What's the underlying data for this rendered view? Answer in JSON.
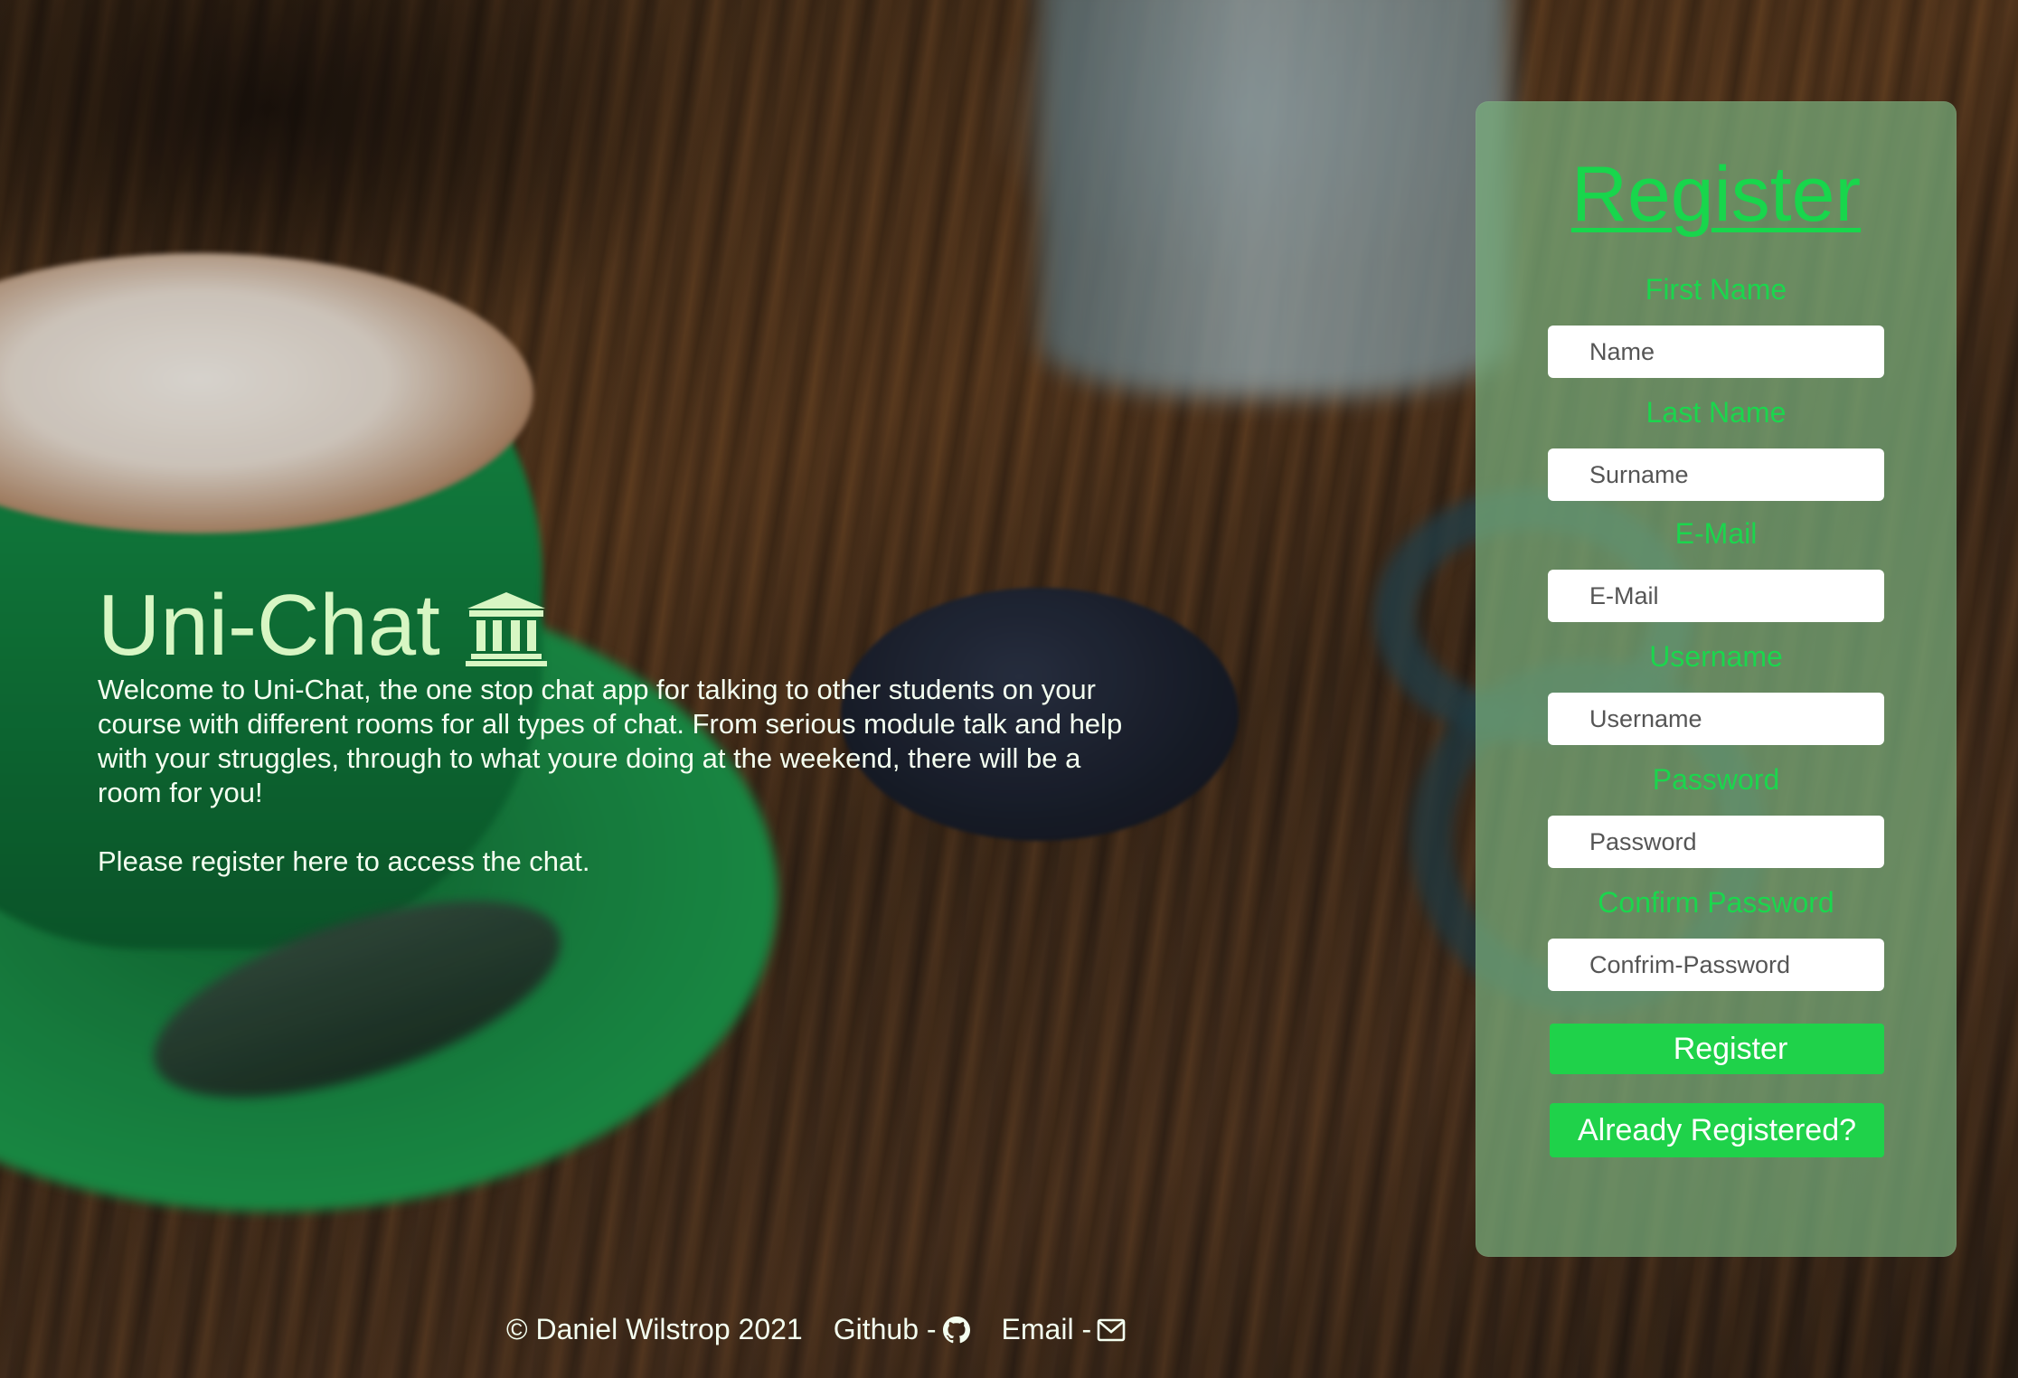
{
  "app": {
    "title": "Uni-Chat",
    "title_icon": "bank-icon"
  },
  "hero": {
    "description": "Welcome to Uni-Chat, the one stop chat app for talking to other students on your course with different rooms for all types of chat. From serious module talk and help with your struggles, through to what youre doing at the weekend, there will be a room for you!",
    "cta": "Please register here to access the chat."
  },
  "register_form": {
    "heading": "Register",
    "fields": [
      {
        "label": "First Name",
        "placeholder": "Name"
      },
      {
        "label": "Last Name",
        "placeholder": "Surname"
      },
      {
        "label": "E-Mail",
        "placeholder": "E-Mail"
      },
      {
        "label": "Username",
        "placeholder": "Username"
      },
      {
        "label": "Password",
        "placeholder": "Password"
      },
      {
        "label": "Confirm Password",
        "placeholder": "Confrim-Password"
      }
    ],
    "submit_label": "Register",
    "login_label": "Already Registered?"
  },
  "footer": {
    "copyright": "© Daniel Wilstrop 2021",
    "github_label": "Github -",
    "github_icon": "github-icon",
    "email_label": "Email -",
    "email_icon": "envelope-icon"
  },
  "colors": {
    "accent_green": "#1fd24a",
    "card_background": "rgba(120,175,125,0.72)",
    "hero_text": "#d7f6c3"
  }
}
